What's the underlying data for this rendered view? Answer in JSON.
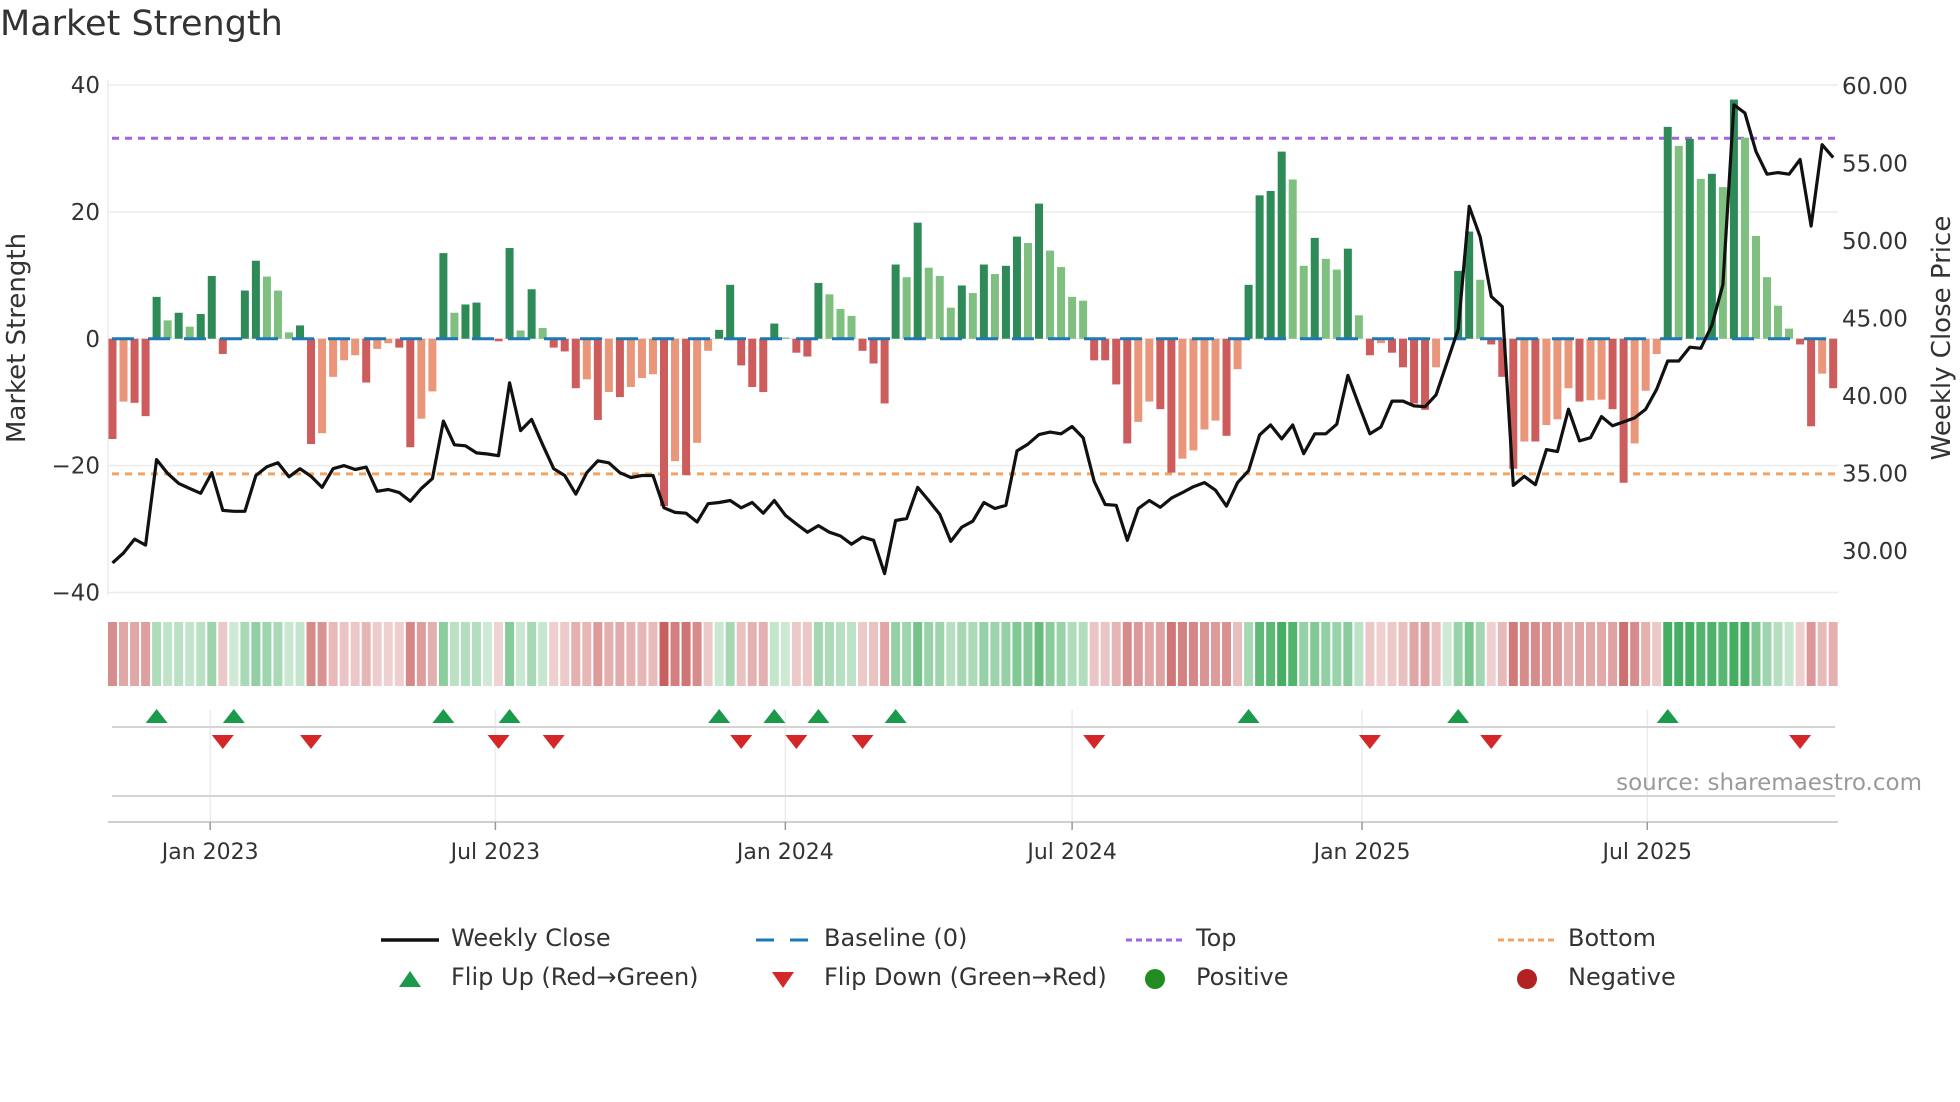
{
  "title": "Market Strength",
  "source": "source: sharemaestro.com",
  "chart_data": {
    "type": "bar",
    "title": "Market Strength",
    "ylabel": "Market Strength",
    "y2label": "Weekly Close Price",
    "ylim": [
      -40,
      40
    ],
    "y2lim": [
      30,
      60
    ],
    "yticks": [
      "40",
      "20",
      "0",
      "−20",
      "−40"
    ],
    "yticks_values": [
      40,
      20,
      0,
      -20,
      -40
    ],
    "y2ticks": [
      "60.00",
      "55.00",
      "50.00",
      "45.00",
      "40.00",
      "35.00",
      "30.00"
    ],
    "y2ticks_values": [
      60,
      55,
      50,
      45,
      40,
      35,
      30
    ],
    "xticks": [
      {
        "label": "Jan 2023",
        "date": "2023-01-01"
      },
      {
        "label": "Jul 2023",
        "date": "2023-07-01"
      },
      {
        "label": "Jan 2024",
        "date": "2024-01-01"
      },
      {
        "label": "Jul 2024",
        "date": "2024-07-01"
      },
      {
        "label": "Jan 2025",
        "date": "2025-01-01"
      },
      {
        "label": "Jul 2025",
        "date": "2025-07-01"
      }
    ],
    "start_date": "2022-10-31",
    "frequency": "weekly",
    "top_level": 31.6,
    "bottom_level": -21.3,
    "baseline": 0,
    "grid": true,
    "legend_placement": "bottom",
    "strength": [
      -15.8,
      -9.9,
      -10.1,
      -12.2,
      6.6,
      2.9,
      4.1,
      1.9,
      3.9,
      9.9,
      -2.4,
      0,
      7.6,
      12.3,
      9.8,
      7.6,
      1.0,
      2.1,
      -16.6,
      -14.9,
      -6.0,
      -3.4,
      -2.6,
      -6.9,
      -1.6,
      -0.7,
      -1.4,
      -17.1,
      -12.6,
      -8.3,
      13.5,
      4.1,
      5.4,
      5.7,
      0,
      -0.4,
      14.3,
      1.3,
      7.8,
      1.7,
      -1.4,
      -2.0,
      -7.8,
      -6.4,
      -12.8,
      -8.4,
      -9.2,
      -7.6,
      -6.2,
      -5.6,
      -26.4,
      -19.3,
      -21.5,
      -16.4,
      -1.9,
      1.4,
      8.5,
      -4.2,
      -7.6,
      -8.4,
      2.4,
      0.2,
      -2.2,
      -2.8,
      8.8,
      7.0,
      4.7,
      3.6,
      -1.9,
      -3.9,
      -10.2,
      11.7,
      9.7,
      18.3,
      11.2,
      9.9,
      4.9,
      8.4,
      7.2,
      11.7,
      10.2,
      11.5,
      16.1,
      15.1,
      21.3,
      13.9,
      11.3,
      6.6,
      6.0,
      -3.4,
      -3.4,
      -7.2,
      -16.5,
      -13.1,
      -9.9,
      -11.1,
      -21.1,
      -18.9,
      -17.6,
      -14.3,
      -12.9,
      -15.3,
      -4.8,
      8.5,
      22.6,
      23.3,
      29.5,
      25.1,
      11.5,
      15.9,
      12.6,
      10.9,
      14.2,
      3.7,
      -2.6,
      -0.7,
      -2.2,
      -4.5,
      -10.2,
      -11.2,
      -4.5,
      0,
      10.7,
      16.9,
      9.3,
      -0.9,
      -6.0,
      -20.5,
      -16.2,
      -16.2,
      -13.6,
      -12.7,
      -7.8,
      -9.9,
      -9.7,
      -9.6,
      -11.1,
      -22.7,
      -16.5,
      -8.2,
      -2.4,
      33.4,
      30.4,
      31.5,
      25.2,
      26.0,
      23.9,
      37.7,
      31.7,
      16.2,
      9.7,
      5.2,
      1.6,
      -0.9,
      -13.8,
      -5.5,
      -7.8
    ],
    "weekly_close": [
      29.23,
      29.87,
      30.77,
      30.38,
      35.9,
      35.0,
      34.36,
      34.03,
      33.72,
      35.05,
      32.62,
      32.56,
      32.56,
      34.87,
      35.44,
      35.69,
      34.79,
      35.31,
      34.82,
      34.1,
      35.31,
      35.51,
      35.26,
      35.41,
      33.85,
      33.97,
      33.77,
      33.21,
      34.03,
      34.67,
      38.38,
      36.85,
      36.79,
      36.33,
      36.26,
      36.15,
      40.85,
      37.77,
      38.49,
      36.85,
      35.31,
      34.87,
      33.67,
      35.05,
      35.82,
      35.69,
      35.05,
      34.74,
      34.87,
      34.87,
      32.79,
      32.49,
      32.44,
      31.87,
      33.05,
      33.13,
      33.26,
      32.79,
      33.13,
      32.44,
      33.26,
      32.31,
      31.74,
      31.21,
      31.64,
      31.21,
      30.97,
      30.44,
      30.9,
      30.69,
      28.54,
      31.97,
      32.1,
      34.1,
      33.26,
      32.36,
      30.62,
      31.54,
      31.92,
      33.13,
      32.74,
      32.95,
      36.46,
      36.9,
      37.51,
      37.67,
      37.56,
      38.03,
      37.31,
      34.49,
      33.0,
      32.95,
      30.69,
      32.74,
      33.26,
      32.82,
      33.41,
      33.77,
      34.15,
      34.41,
      33.92,
      32.9,
      34.41,
      35.18,
      37.49,
      38.13,
      37.23,
      38.13,
      36.28,
      37.56,
      37.56,
      38.18,
      41.33,
      39.41,
      37.56,
      38.0,
      39.67,
      39.67,
      39.36,
      39.31,
      40.08,
      42.18,
      44.31,
      52.23,
      50.26,
      46.41,
      45.77,
      34.23,
      34.82,
      34.28,
      36.54,
      36.41,
      39.15,
      37.1,
      37.31,
      38.67,
      38.08,
      38.33,
      38.59,
      39.15,
      40.44,
      42.26,
      42.26,
      43.15,
      43.08,
      44.54,
      47.18,
      58.79,
      58.26,
      55.77,
      54.31,
      54.41,
      54.31,
      55.26,
      50.97,
      56.21,
      55.38
    ],
    "flip_up_weeks": [
      4,
      11,
      30,
      36,
      55,
      60,
      64,
      71,
      103,
      122,
      141
    ],
    "flip_down_weeks": [
      10,
      18,
      35,
      40,
      57,
      62,
      68,
      89,
      114,
      125,
      153
    ],
    "legend": [
      {
        "label": "Weekly Close",
        "kind": "line"
      },
      {
        "label": "Baseline (0)",
        "kind": "dash"
      },
      {
        "label": "Top",
        "kind": "dot-purple"
      },
      {
        "label": "Bottom",
        "kind": "dot-orange"
      },
      {
        "label": "Flip Up (Red→Green)",
        "kind": "tri-up"
      },
      {
        "label": "Flip Down (Green→Red)",
        "kind": "tri-down"
      },
      {
        "label": "Positive",
        "kind": "circle-green"
      },
      {
        "label": "Negative",
        "kind": "circle-red"
      }
    ],
    "colors": {
      "pos_strong": "#2e8b57",
      "pos_weak": "#7fbf7f",
      "neg_strong": "#cd5c5c",
      "neg_weak": "#e9967a",
      "close": "#111111",
      "baseline": "#1f77b4",
      "top": "#a066e0",
      "bottom": "#f4a460",
      "flip_up": "#1a9a4a",
      "flip_down": "#d62728",
      "positive": "#228b22",
      "negative": "#b22222"
    }
  }
}
